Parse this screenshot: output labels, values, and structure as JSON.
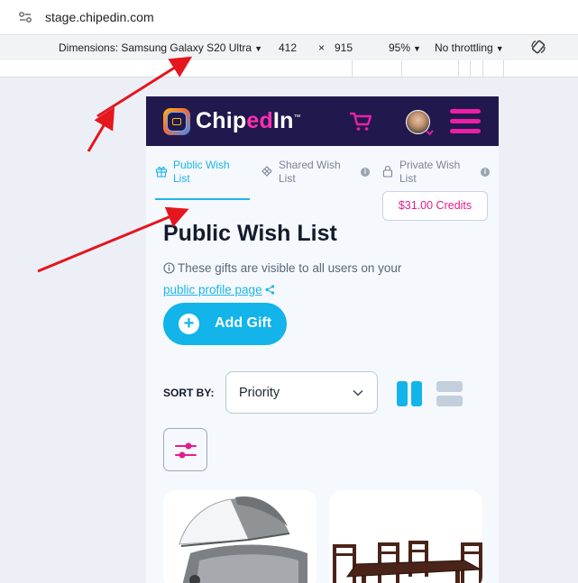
{
  "browser": {
    "url": "stage.chipedin.com",
    "device_label": "Dimensions: Samsung Galaxy S20 Ultra",
    "width_value": "412",
    "times_sign": "×",
    "height_value": "915",
    "zoom": "95%",
    "throttling": "No throttling"
  },
  "app": {
    "logo_text_prefix": "Chip",
    "logo_text_accent": "ed",
    "logo_text_suffix": "In",
    "logo_trademark": "™",
    "colors": {
      "header_bg": "#21194d",
      "accent_pink": "#ec1fa6",
      "accent_blue": "#12b4ea"
    }
  },
  "tabs": [
    {
      "label": "Public Wish List",
      "icon": "gift-icon",
      "active": true
    },
    {
      "label": "Shared Wish List",
      "icon": "gift-outline-icon",
      "active": false,
      "info": "i"
    },
    {
      "label": "Private Wish List",
      "icon": "lock-icon",
      "active": false,
      "info": "i"
    }
  ],
  "credits_label": "$31.00 Credits",
  "page_title": "Public Wish List",
  "notice": {
    "text": "These gifts are visible to all users on your",
    "link": "public profile page"
  },
  "add_gift": {
    "icon": "+",
    "label": "Add Gift"
  },
  "sort": {
    "label": "SORT BY:",
    "selected": "Priority",
    "view_modes": [
      "grid",
      "list"
    ],
    "active_view": "grid"
  },
  "products": [
    {
      "image": "stroller-bassinet"
    },
    {
      "image": "dining-table-set"
    }
  ]
}
